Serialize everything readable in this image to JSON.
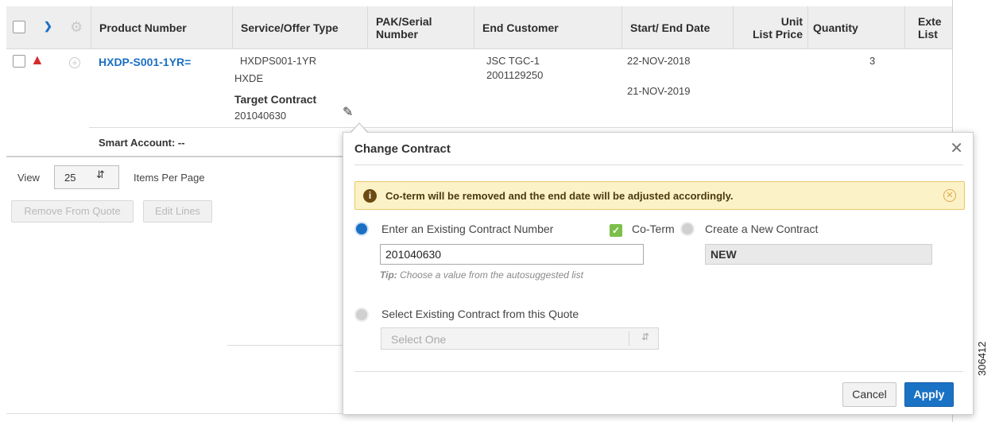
{
  "table": {
    "headers": {
      "product_number": "Product Number",
      "service_offer_type": "Service/Offer Type",
      "pak_serial": [
        "PAK/Serial",
        "Number"
      ],
      "end_customer": "End Customer",
      "start_end_date": "Start/ End Date",
      "unit_list_price": [
        "Unit",
        "List Price"
      ],
      "quantity": "Quantity",
      "extended_list": [
        "Exte",
        "List"
      ]
    },
    "row": {
      "product_number": "HXDP-S001-1YR=",
      "service_offer_type": "HXDPS001-1YR",
      "service_level": "HXDE",
      "target_contract_label": "Target Contract",
      "target_contract_value": "201040630",
      "end_customer": "JSC TGC-1",
      "end_customer_id": "2001129250",
      "start_date": "22-NOV-2018",
      "end_date": "21-NOV-2019",
      "quantity": "3"
    },
    "smart_account": "Smart Account: --"
  },
  "pagination": {
    "view_label": "View",
    "page_size": "25",
    "items_per_page": "Items Per Page"
  },
  "actions": {
    "remove_from_quote": "Remove From Quote",
    "edit_lines": "Edit Lines"
  },
  "modal": {
    "title": "Change Contract",
    "alert": "Co-term will be removed and the end date will be adjusted accordingly.",
    "option_existing": "Enter an Existing Contract Number",
    "coterm_label": "Co-Term",
    "option_new": "Create a New Contract",
    "contract_input_value": "201040630",
    "new_contract_value": "NEW",
    "tip_prefix": "Tip:",
    "tip_text": " Choose a value from the autosuggested list",
    "option_select_quote": "Select Existing Contract from this Quote",
    "select_placeholder": "Select One",
    "cancel_label": "Cancel",
    "apply_label": "Apply"
  },
  "figure_id": "306412",
  "colors": {
    "accent_blue": "#1a6fc4",
    "warning_red": "#d62c2c",
    "alert_bg": "#fcf2c8",
    "coterm_green": "#7bbf4a"
  }
}
